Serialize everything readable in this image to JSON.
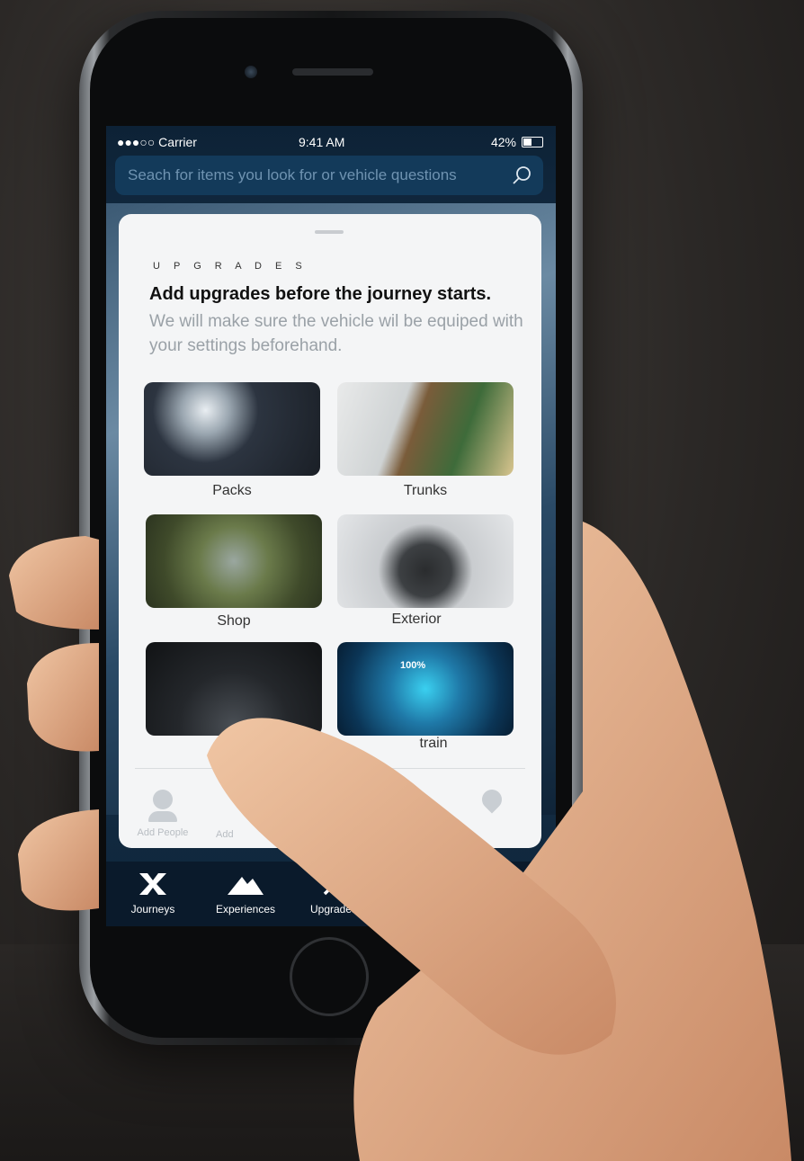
{
  "status_bar": {
    "carrier": "●●●○○ Carrier",
    "time": "9:41 AM",
    "battery": "42%"
  },
  "search": {
    "placeholder": "Seach for items you look for or vehicle questions"
  },
  "card": {
    "eyebrow": "U P G R A D E S",
    "title": "Add upgrades before the journey starts.",
    "subtitle": "We will make sure the vehicle wil be equiped with your settings beforehand.",
    "tiles": [
      {
        "label": "Packs"
      },
      {
        "label": "Trunks"
      },
      {
        "label": "Shop"
      },
      {
        "label": "Exterior"
      },
      {
        "label": ""
      },
      {
        "label": "train"
      }
    ],
    "powertrain_badge": "100%",
    "bottom_actions": [
      "Add People",
      "Add"
    ]
  },
  "tabs": [
    {
      "label": "Journeys",
      "icon": "x-logo-icon"
    },
    {
      "label": "Experiences",
      "icon": "mountain-icon"
    },
    {
      "label": "Upgrades",
      "icon": "double-chevron-up-icon"
    }
  ],
  "colors": {
    "screen_bg": "#0d2236",
    "search_bg": "#133a5a",
    "card_bg": "#f4f5f6",
    "tabbar_bg": "#0a1a2b"
  }
}
